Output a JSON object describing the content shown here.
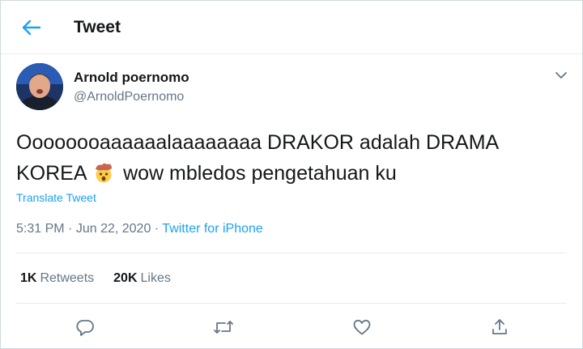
{
  "header": {
    "title": "Tweet",
    "back_icon": "arrow-left-icon"
  },
  "author": {
    "name": "Arnold poernomo",
    "handle": "@ArnoldPoernomo"
  },
  "tweet": {
    "text_part1": "Oooooooaaaaaalaaaaaaaa DRAKOR adalah DRAMA KOREA",
    "emoji": "exploding-head-emoji",
    "text_part2": "wow mbledos pengetahuan ku",
    "translate_label": "Translate Tweet",
    "time": "5:31 PM",
    "date": "Jun 22, 2020",
    "separator": "·",
    "source": "Twitter for iPhone"
  },
  "stats": {
    "retweets_count": "1K",
    "retweets_label": "Retweets",
    "likes_count": "20K",
    "likes_label": "Likes"
  },
  "actions": [
    "reply-icon",
    "retweet-icon",
    "like-icon",
    "share-icon"
  ],
  "colors": {
    "accent": "#1da1f2",
    "text": "#14171a",
    "muted": "#657786",
    "border": "#e6ecf0"
  }
}
